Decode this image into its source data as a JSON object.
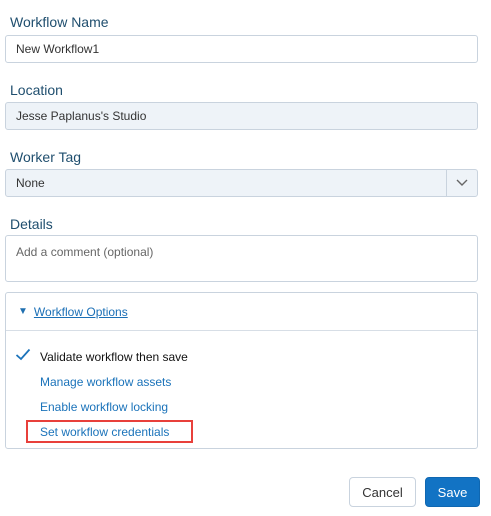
{
  "form": {
    "workflow_name": {
      "label": "Workflow Name",
      "value": "New Workflow1"
    },
    "location": {
      "label": "Location",
      "value": "Jesse Paplanus's Studio"
    },
    "worker_tag": {
      "label": "Worker Tag",
      "value": "None",
      "icon": "chevron-down-icon"
    },
    "details": {
      "label": "Details",
      "placeholder": "Add a comment (optional)"
    }
  },
  "options": {
    "title": "Workflow Options",
    "expanded": true,
    "validate_checkbox": {
      "label": "Validate workflow then save",
      "checked": true
    },
    "links": [
      "Manage workflow assets",
      "Enable workflow locking",
      "Set workflow credentials"
    ]
  },
  "footer": {
    "cancel_label": "Cancel",
    "save_label": "Save"
  },
  "colors": {
    "accent": "#1273c4",
    "link": "#1b73ba",
    "highlight": "#e8403b"
  }
}
